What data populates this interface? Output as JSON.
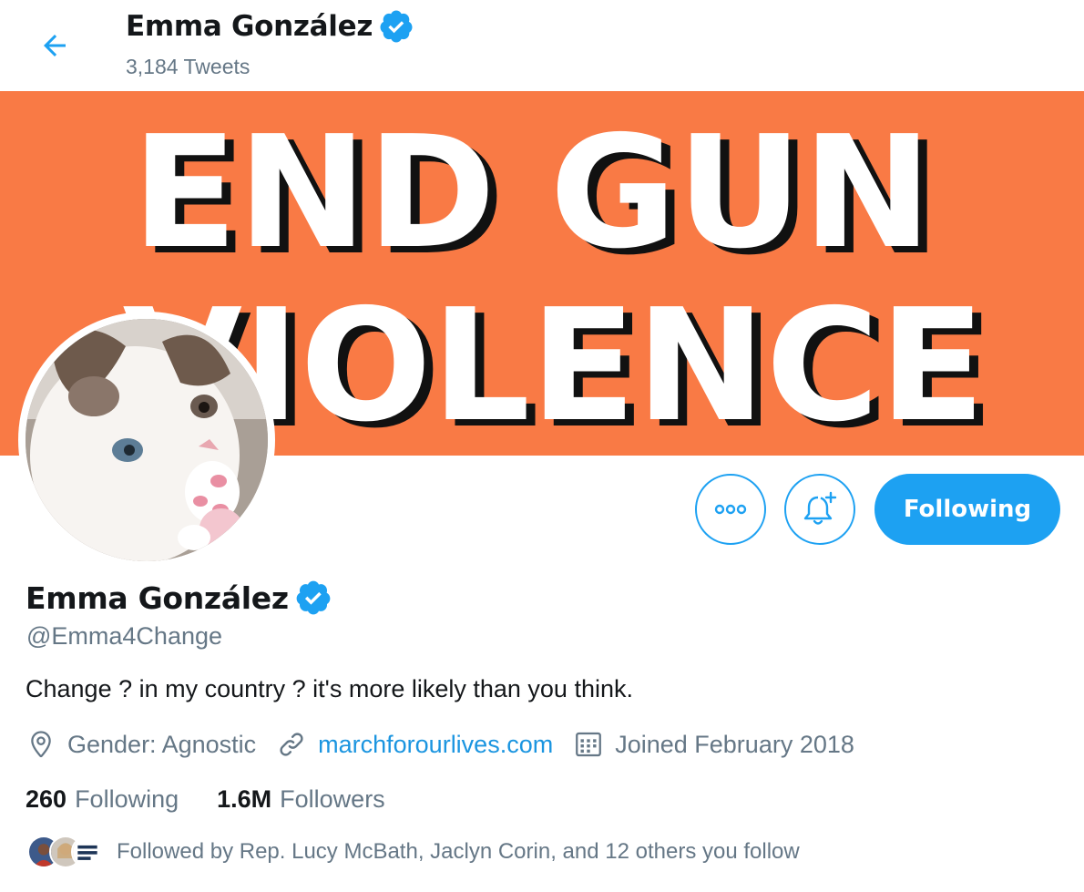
{
  "header": {
    "name": "Emma González",
    "tweet_count": "3,184 Tweets"
  },
  "banner": {
    "line1": "END GUN",
    "line2": "VIOLENCE",
    "background_color": "#f97a45"
  },
  "actions": {
    "more_icon": "more-icon",
    "notify_icon": "bell-plus-icon",
    "following_label": "Following"
  },
  "profile": {
    "name": "Emma González",
    "handle": "@Emma4Change",
    "bio": "Change ? in my country ? it's more likely than you think.",
    "location": "Gender: Agnostic",
    "website": "marchforourlives.com",
    "joined": "Joined February 2018"
  },
  "stats": {
    "following_count": "260",
    "following_label": "Following",
    "followers_count": "1.6M",
    "followers_label": "Followers"
  },
  "followed_by": {
    "text": "Followed by Rep. Lucy McBath, Jaclyn Corin, and 12 others you follow"
  },
  "colors": {
    "accent": "#1da1f2",
    "link": "#1b95e0",
    "secondary_text": "#657786"
  }
}
